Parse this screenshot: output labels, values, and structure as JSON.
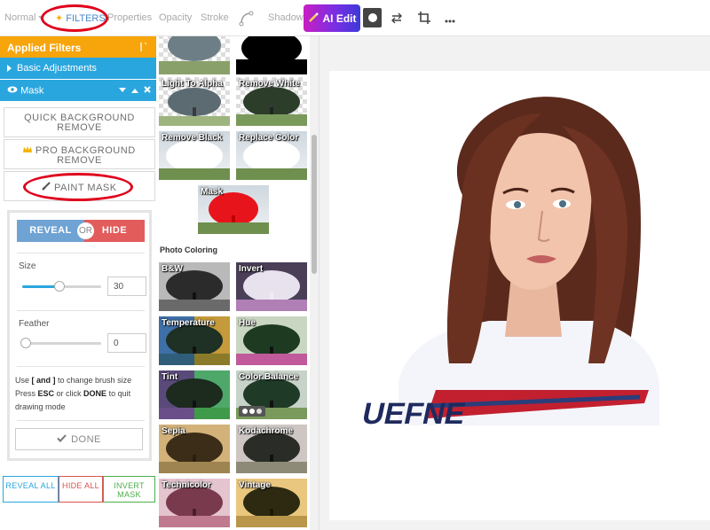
{
  "toolbar": {
    "normal": "Normal",
    "filters": "FILTERS",
    "properties": "Properties",
    "opacity": "Opacity",
    "stroke": "Stroke",
    "shadow": "Shadow",
    "ai_edit": "AI Edit"
  },
  "panel": {
    "applied_filters": "Applied Filters",
    "basic_adjustments": "Basic Adjustments",
    "mask": "Mask",
    "quick_bg_remove": "QUICK BACKGROUND REMOVE",
    "pro_bg_remove": "PRO BACKGROUND REMOVE",
    "paint_mask": "PAINT MASK",
    "reveal": "REVEAL",
    "or": "OR",
    "hide": "HIDE",
    "size_label": "Size",
    "size_value": "30",
    "size_level": 0.47,
    "feather_label": "Feather",
    "feather_value": "0",
    "feather_level": 0,
    "help_line1_pre": "Use ",
    "help_line1_keys": "[ and ]",
    "help_line1_post": " to change brush size",
    "help_line2_pre": "Press ",
    "help_line2_key": "ESC",
    "help_line2_mid": " or click ",
    "help_line2_done": "DONE",
    "help_line2_post": " to quit drawing mode",
    "done": "DONE",
    "reveal_all": "REVEAL ALL",
    "hide_all": "HIDE ALL",
    "invert_mask": "INVERT MASK"
  },
  "filters": {
    "light_to_alpha": "Light To Alpha",
    "remove_white": "Remove White",
    "remove_black": "Remove Black",
    "replace_color": "Replace Color",
    "mask": "Mask",
    "section_photo_coloring": "Photo Coloring",
    "bw": "B&W",
    "invert": "Invert",
    "temperature": "Temperature",
    "hue": "Hue",
    "tint": "Tint",
    "color_balance": "Color Balance",
    "sepia": "Sepia",
    "kodachrome": "Kodachrome",
    "technicolor": "Technicolor",
    "vintage": "Vintage"
  },
  "canvas": {
    "shirt_text": "UEFNE"
  },
  "colors": {
    "accent_orange": "#f7a50b",
    "accent_blue": "#2aa6de",
    "reveal_blue": "#6fa3d4",
    "hide_red": "#e35c5c",
    "highlight_red": "#e0001c",
    "invert_green": "#4cae4c",
    "hide_all_red": "#d9534f"
  }
}
